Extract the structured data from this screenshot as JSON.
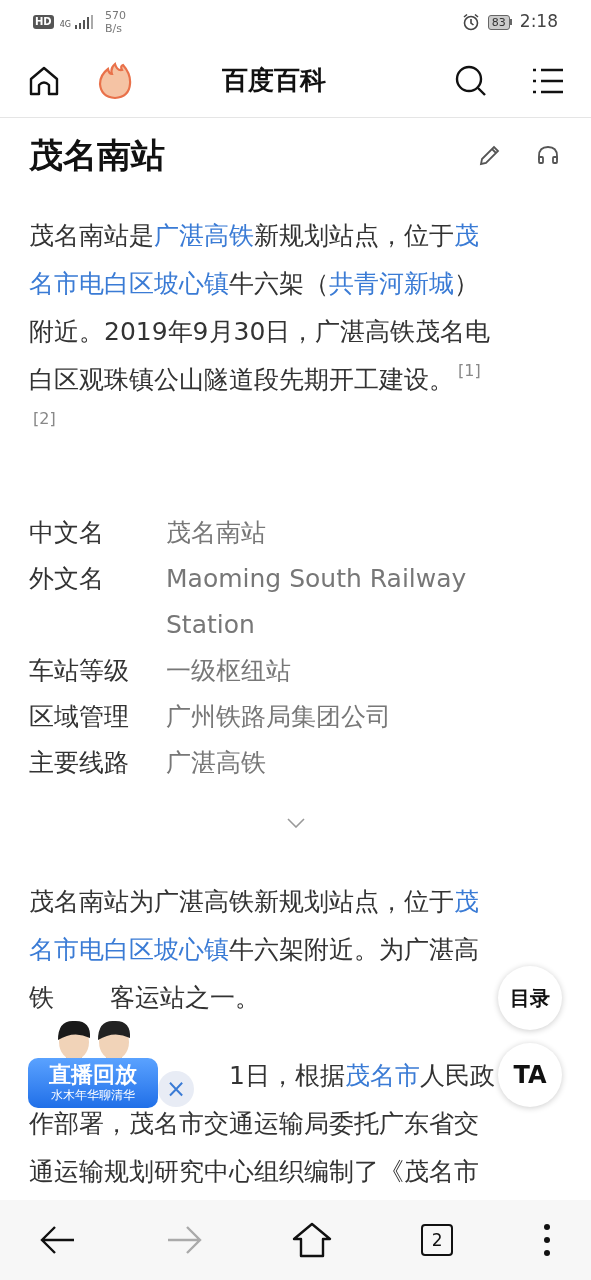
{
  "status_bar": {
    "hd": "HD",
    "network": "4G",
    "speed_value": "570",
    "speed_unit": "B/s",
    "battery": "83",
    "time": "2:18"
  },
  "header": {
    "title": "百度百科"
  },
  "article": {
    "title": "茂名南站",
    "intro": [
      [
        {
          "text": "茂名南站是",
          "link": false
        },
        {
          "text": "广湛高铁",
          "link": true
        },
        {
          "text": "新规划站点，位于",
          "link": false
        },
        {
          "text": "茂",
          "link": true
        }
      ],
      [
        {
          "text": "名市电白区坡心镇",
          "link": true
        },
        {
          "text": "牛六架（",
          "link": false
        },
        {
          "text": "共青河新城",
          "link": true
        },
        {
          "text": "）",
          "link": false
        }
      ],
      [
        {
          "text": "附近。2019年9月30日，广湛高铁茂名电",
          "link": false
        }
      ],
      [
        {
          "text": "白区观珠镇公山隧道段先期开工建设。",
          "link": false
        },
        {
          "text": "[1]",
          "kind": "ref"
        }
      ],
      [
        {
          "text": "[2]",
          "kind": "ref"
        }
      ]
    ],
    "infobox": [
      {
        "label": "中文名",
        "value": "茂名南站"
      },
      {
        "label": "外文名",
        "value": "Maoming South Railway Station"
      },
      {
        "label": "车站等级",
        "value": "一级枢纽站"
      },
      {
        "label": "区域管理",
        "value": "广州铁路局集团公司"
      },
      {
        "label": "主要线路",
        "value": "广湛高铁"
      }
    ],
    "infobox_expanded": false,
    "body": [
      [
        [
          {
            "text": "茂名南站为广湛高铁新规划站点，位于",
            "link": false
          },
          {
            "text": "茂",
            "link": true
          }
        ],
        [
          {
            "text": "名市电白区坡心镇",
            "link": true
          },
          {
            "text": "牛六架附近。为广湛高",
            "link": false
          }
        ],
        [
          {
            "text": "铁",
            "link": false
          },
          {
            "kind": "gap_short"
          },
          {
            "text": "客运站之一。",
            "link": false
          }
        ]
      ],
      [
        [
          {
            "kind": "gap_long"
          },
          {
            "text": "1日，根据",
            "link": false
          },
          {
            "text": "茂名市",
            "link": true
          },
          {
            "text": "人民政",
            "link": false
          }
        ],
        [
          {
            "text": "作部署，茂名市交通运输局委托广东省交",
            "link": false
          }
        ],
        [
          {
            "text": "通运输规划研究中心组织编制了《茂名市",
            "link": false
          }
        ]
      ]
    ]
  },
  "floating": {
    "toc": "目录",
    "ta": "TA"
  },
  "live_banner": {
    "title": "直播回放",
    "subtitle": "水木年华聊清华",
    "close": "×"
  },
  "bottom_bar": {
    "forward_disabled": true,
    "tabs_count": "2"
  }
}
